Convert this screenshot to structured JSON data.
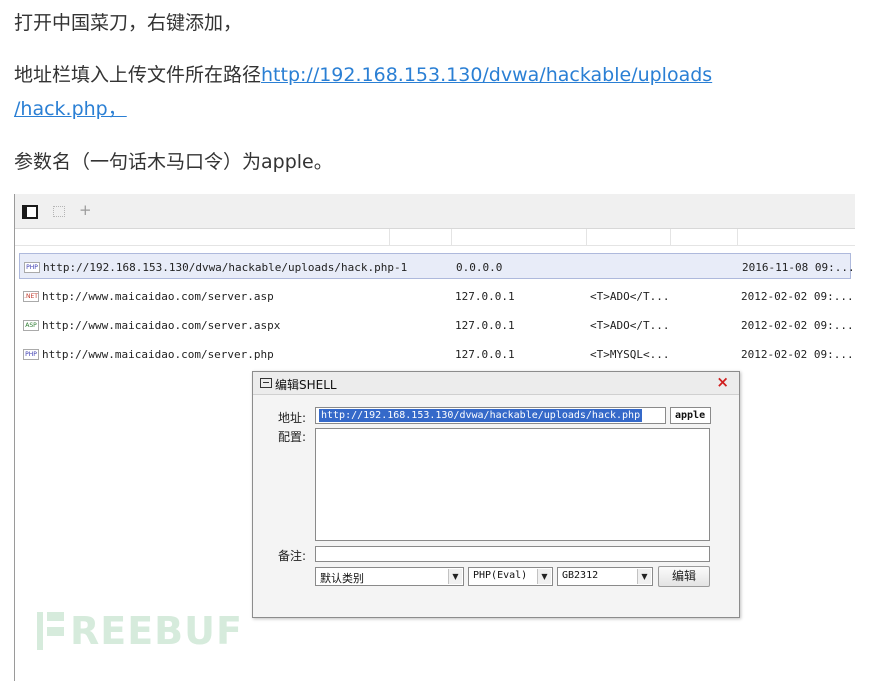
{
  "article": {
    "p1": "打开中国菜刀，右键添加，",
    "p2_prefix": "地址栏填入上传文件所在路径",
    "p2_link_line1": "http://192.168.153.130/dvwa/hackable/uploads",
    "p2_link_line2": "/hack.php，",
    "p3": "参数名（一句话木马口令）为apple。"
  },
  "tool": {
    "tab_add": "+",
    "rows": [
      {
        "icon": "PHP",
        "url": "http://192.168.153.130/dvwa/hackable/uploads/hack.php",
        "ip_code": "-1",
        "ip": "0.0.0.0",
        "type": "",
        "time": "2016-11-08 09:..."
      },
      {
        "icon": ".NET",
        "url": "http://www.maicaidao.com/server.asp",
        "ip_code": "",
        "ip": "127.0.0.1",
        "type": "<T>ADO</T...",
        "time": "2012-02-02 09:..."
      },
      {
        "icon": "ASP",
        "url": "http://www.maicaidao.com/server.aspx",
        "ip_code": "",
        "ip": "127.0.0.1",
        "type": "<T>ADO</T...",
        "time": "2012-02-02 09:..."
      },
      {
        "icon": "PHP",
        "url": "http://www.maicaidao.com/server.php",
        "ip_code": "",
        "ip": "127.0.0.1",
        "type": "<T>MYSQL<...",
        "time": "2012-02-02 09:..."
      }
    ],
    "dialog": {
      "title": "编辑SHELL",
      "close": "×",
      "address_label": "地址:",
      "address_value": "http://192.168.153.130/dvwa/hackable/uploads/hack.php",
      "password_value": "apple",
      "config_label": "配置:",
      "config_value": "",
      "note_label": "备注:",
      "note_value": "",
      "category": "默认类别",
      "script_type": "PHP(Eval)",
      "encoding": "GB2312",
      "save_button": "编辑"
    },
    "watermark": "REEBUF"
  },
  "colors": {
    "link": "#2a7fd4",
    "selection": "#3569c9",
    "close_icon": "#d01e1e",
    "selected_row": "#e8ecf8"
  }
}
